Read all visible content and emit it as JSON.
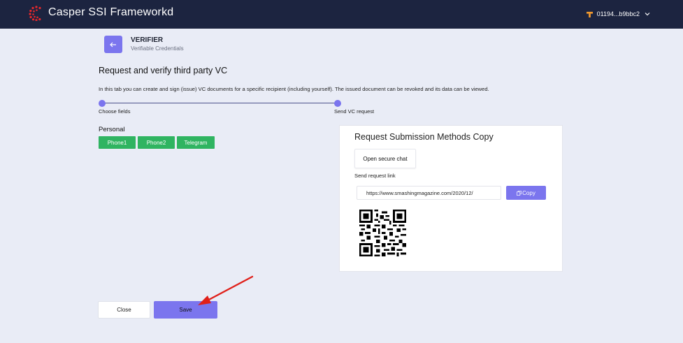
{
  "header": {
    "title": "Casper SSI Frameworkd",
    "account_label": "01194...b9bbc2",
    "logo_icon": "casper-logo-icon",
    "account_icon": "casper-token-icon"
  },
  "module": {
    "title": "VERIFIER",
    "subtitle": "Verifiable Credentials"
  },
  "page": {
    "title": "Request and verify third party VC",
    "description": "In this tab you can create and sign (issue) VC documents for a specific recipient (including yourself). The issued document can be revoked and its data can be viewed."
  },
  "stepper": {
    "steps": [
      {
        "label": "Choose fields"
      },
      {
        "label": "Send VC request"
      }
    ]
  },
  "fields": {
    "section_label": "Personal",
    "chips": [
      "Phone1",
      "Phone2",
      "Telegram"
    ]
  },
  "submission": {
    "title": "Request Submission Methods Copy",
    "chat_button": "Open secure chat",
    "link_label": "Send request link",
    "link_value": "https://www.smashingmagazine.com/2020/12/",
    "copy_button": "Copy"
  },
  "footer": {
    "close_label": "Close",
    "save_label": "Save"
  },
  "colors": {
    "accent": "#7b75ee",
    "topbar": "#1c2440",
    "chip": "#2fb461",
    "background": "#e9ecf6",
    "annotation_arrow": "#e0201a"
  }
}
